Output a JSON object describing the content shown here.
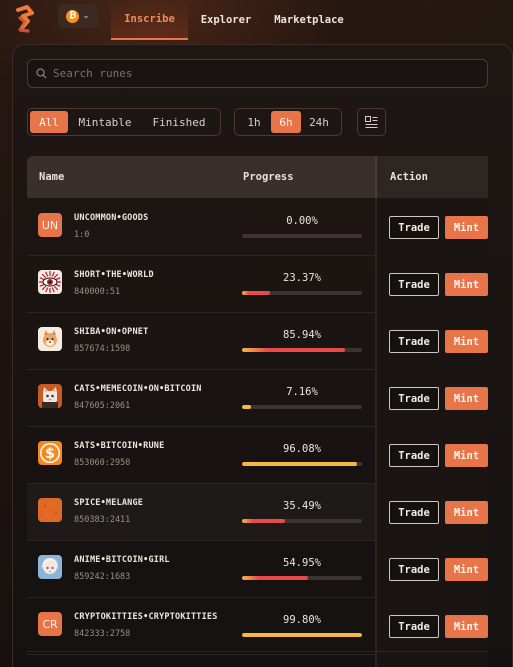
{
  "nav": {
    "chain": "bitcoin",
    "chain_symbol": "₿",
    "tabs": [
      {
        "label": "Inscribe",
        "active": true
      },
      {
        "label": "Explorer",
        "active": false
      },
      {
        "label": "Marketplace",
        "active": false
      }
    ]
  },
  "search": {
    "placeholder": "Search runes"
  },
  "filters": {
    "status": [
      {
        "label": "All",
        "active": true
      },
      {
        "label": "Mintable",
        "active": false
      },
      {
        "label": "Finished",
        "active": false
      }
    ],
    "time": [
      {
        "label": "1h",
        "active": false
      },
      {
        "label": "6h",
        "active": true
      },
      {
        "label": "24h",
        "active": false
      }
    ]
  },
  "table": {
    "headers": {
      "name": "Name",
      "progress": "Progress",
      "action": "Action"
    },
    "trade_label": "Trade",
    "mint_label": "Mint",
    "rows": [
      {
        "name": "UNCOMMON•GOODS",
        "id": "1:0",
        "progress_label": "0.00%",
        "progress": 0.0,
        "icon": "UN",
        "icon_color": "#e8744a",
        "bar_color": "#e8744a"
      },
      {
        "name": "SHORT•THE•WORLD",
        "id": "840000:51",
        "progress_label": "23.37%",
        "progress": 23.37,
        "icon": "eye-icon",
        "icon_color": "#b3202a",
        "bar_color": "#e84a4a"
      },
      {
        "name": "SHIBA•ON•OPNET",
        "id": "857674:1598",
        "progress_label": "85.94%",
        "progress": 85.94,
        "icon": "shiba-icon",
        "icon_color": "#f3e2c8",
        "bar_color": "#e84a4a"
      },
      {
        "name": "CATS•MEMECOIN•ON•BITCOIN",
        "id": "847605:2061",
        "progress_label": "7.16%",
        "progress": 7.16,
        "icon": "cat-icon",
        "icon_color": "#e07a38",
        "bar_color": "#f5b942"
      },
      {
        "name": "SATS•BITCOIN•RUNE",
        "id": "853060:2950",
        "progress_label": "96.08%",
        "progress": 96.08,
        "icon": "dollar-coin-icon",
        "icon_color": "#f58a1f",
        "bar_color": "#f5b942"
      },
      {
        "name": "SPICE•MELANGE",
        "id": "850383:2411",
        "progress_label": "35.49%",
        "progress": 35.49,
        "icon": "spice-icon",
        "icon_color": "#e8742a",
        "bar_color": "#e84a4a"
      },
      {
        "name": "ANIME•BITCOIN•GIRL",
        "id": "859242:1683",
        "progress_label": "54.95%",
        "progress": 54.95,
        "icon": "anime-girl-icon",
        "icon_color": "#d8c8c0",
        "bar_color": "#e84a4a"
      },
      {
        "name": "CRYPTOKITTIES•CRYPTOKITTIES",
        "id": "842333:2758",
        "progress_label": "99.80%",
        "progress": 99.8,
        "icon": "CR",
        "icon_color": "#e8744a",
        "bar_color": "#f5b942"
      }
    ]
  }
}
